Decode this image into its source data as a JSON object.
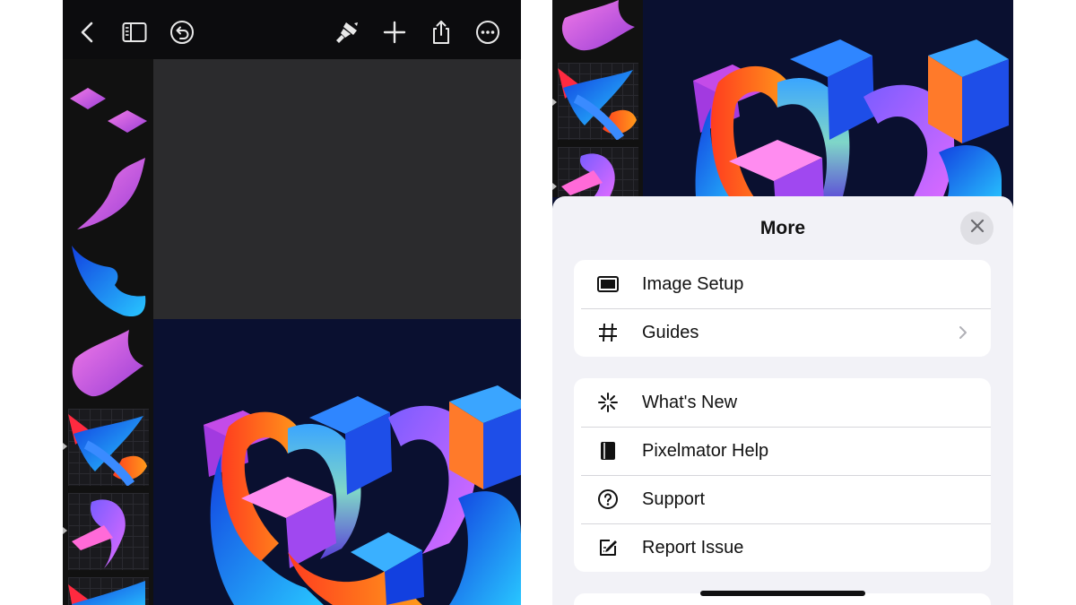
{
  "left_screen": {
    "toolbar": {
      "back_icon": "chevron-left-icon",
      "sidebar_icon": "sidebar-toggle-icon",
      "undo_icon": "undo-icon",
      "paint_icon": "paint-brush-icon",
      "add_icon": "plus-icon",
      "share_icon": "share-icon",
      "more_icon": "ellipsis-circle-icon"
    }
  },
  "more_sheet": {
    "title": "More",
    "close_icon": "xmark-icon",
    "groups": [
      {
        "items": [
          {
            "label": "Image Setup",
            "icon": "image-frame-icon"
          },
          {
            "label": "Guides",
            "icon": "grid-hash-icon",
            "has_chevron": true
          }
        ]
      },
      {
        "items": [
          {
            "label": "What's New",
            "icon": "sparkle-icon"
          },
          {
            "label": "Pixelmator Help",
            "icon": "book-icon"
          },
          {
            "label": "Support",
            "icon": "question-circle-icon"
          },
          {
            "label": "Report Issue",
            "icon": "square-pencil-icon"
          }
        ]
      }
    ]
  },
  "colors": {
    "toolbar_bg": "#0c0c0e",
    "canvas_gray": "#2b2b2d",
    "artwork_bg": "#0a1030",
    "sheet_bg": "#f2f2f7",
    "accent_orange": "#ff5a1a",
    "accent_blue": "#1e6bff",
    "accent_magenta": "#d24fe0"
  }
}
